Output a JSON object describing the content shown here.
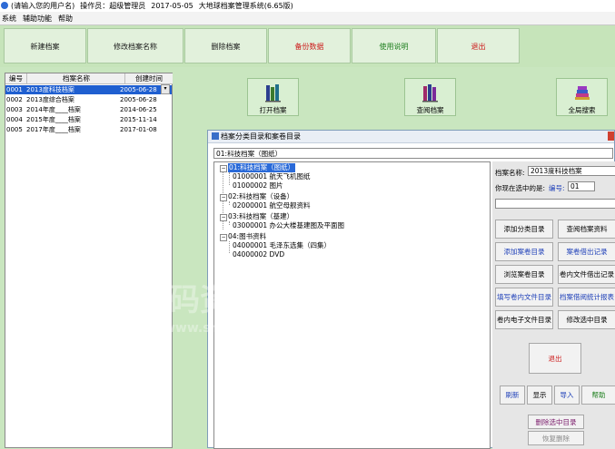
{
  "window": {
    "title_user": "(请输入您的用户名)",
    "title_operator": "操作员：超级管理员",
    "title_date": "2017-05-05",
    "title_app": "大地球档案管理系统(6.65版)"
  },
  "menu": [
    "系统",
    "辅助功能",
    "帮助"
  ],
  "toolbar": {
    "buttons": [
      "新建档案",
      "修改档案名称",
      "删除档案",
      "备份数据",
      "使用说明",
      "退出"
    ]
  },
  "archive_list": {
    "columns": [
      "编号",
      "档案名称",
      "创建时间"
    ],
    "rows": [
      {
        "id": "0001",
        "name": "2013度科技档案",
        "date": "2005-06-28"
      },
      {
        "id": "0002",
        "name": "2013度综合档案",
        "date": "2005-06-28"
      },
      {
        "id": "0003",
        "name": "2014年度____档案",
        "date": "2014-06-25"
      },
      {
        "id": "0004",
        "name": "2015年度____档案",
        "date": "2015-11-14"
      },
      {
        "id": "0005",
        "name": "2017年度____档案",
        "date": "2017-01-08"
      }
    ]
  },
  "actions": {
    "open": "打开档案",
    "query": "查阅档案",
    "fulltext": "全局搜索"
  },
  "dialog": {
    "title": "档案分类目录和案卷目录",
    "combo_value": "01:科技档案（图纸）",
    "tree": [
      {
        "label": "01:科技档案（图纸）",
        "level": 0,
        "highlight": true
      },
      {
        "label": "01000001 航天飞机图纸",
        "level": 1
      },
      {
        "label": "01000002 图片",
        "level": 1
      },
      {
        "label": "02:科技档案（设备）",
        "level": 0
      },
      {
        "label": "02000001 航空母舰资料",
        "level": 1
      },
      {
        "label": "03:科技档案（基建）",
        "level": 0
      },
      {
        "label": "03000001 办公大楼基建图及平面图",
        "level": 1
      },
      {
        "label": "04:图书资料",
        "level": 0
      },
      {
        "label": "04000001 毛泽东选集（四集）",
        "level": 1
      },
      {
        "label": "04000002 DVD",
        "level": 1
      }
    ],
    "archive_name_label": "档案名称:",
    "archive_name_value": "2013度科技档案",
    "selected_label": "你现在选中的是:",
    "code_label": "编号:",
    "code_value": "01",
    "buttons": {
      "add_category": "添加分类目录",
      "query_archive": "查阅档案资料",
      "add_volume": "添加案卷目录",
      "volume_out": "案卷借出记录",
      "browse_volume": "浏览案卷目录",
      "file_out": "卷内文件借出记录",
      "fill_files": "填写卷内文件目录",
      "archive_stats": "档案借阅统计报表",
      "e_files": "卷内电子文件目录",
      "edit_selected": "修改选中目录",
      "exit": "退出",
      "refresh": "刷新",
      "show": "显示",
      "import": "导入",
      "help": "帮助",
      "delete_selected": "删除选中目录",
      "restore_delete": "恢复删除"
    }
  },
  "watermark": {
    "brand": "数码资源网",
    "url": "www.smzy.com"
  },
  "colors": {
    "background": "#c9e6bf",
    "selection": "#1f5fd0",
    "accent_red": "#cc1a1a",
    "accent_green": "#208020"
  }
}
